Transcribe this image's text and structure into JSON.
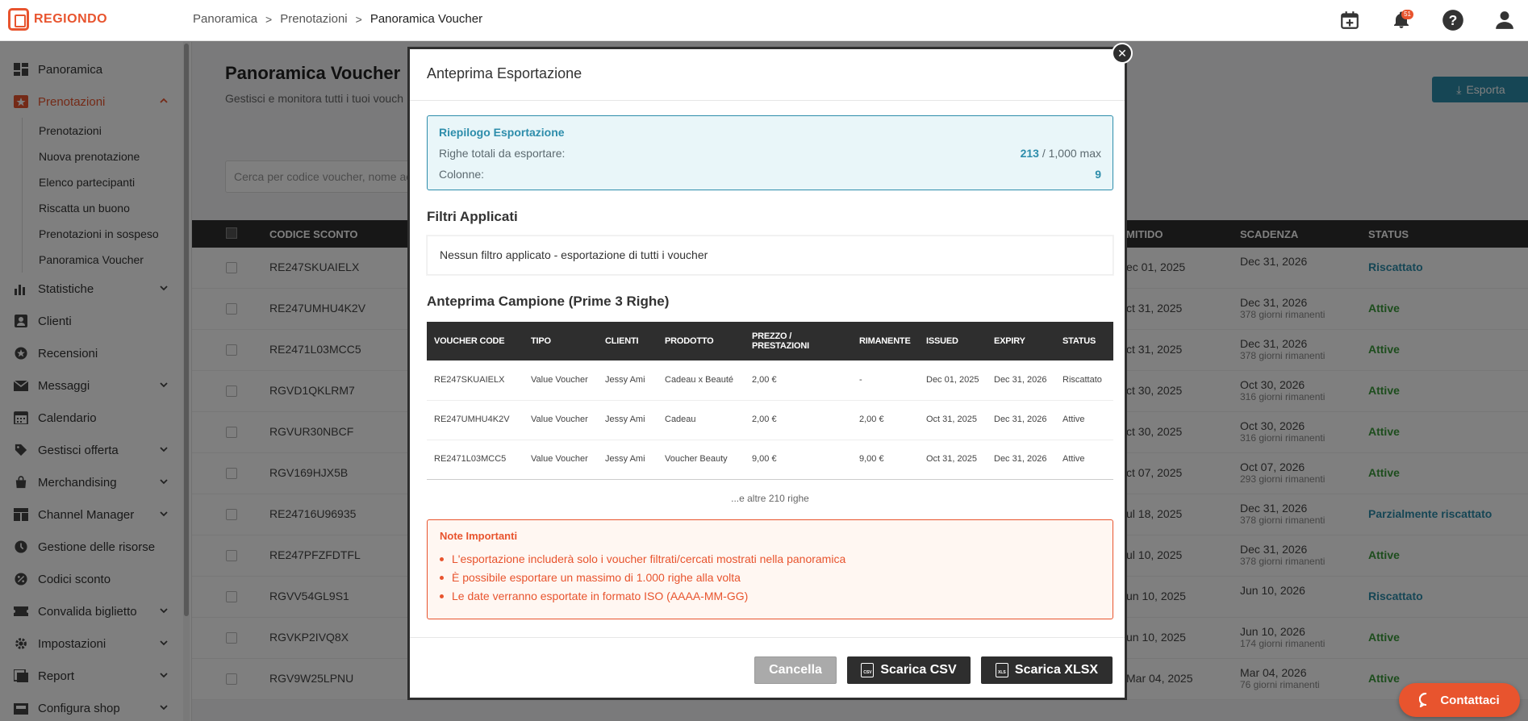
{
  "app": {
    "logo_text": "REGIONDO",
    "brand_color": "#e8542e",
    "accent_color": "#2d8dab"
  },
  "breadcrumb": [
    "Panoramica",
    "Prenotazioni",
    "Panoramica Voucher"
  ],
  "header": {
    "notif_count": "51"
  },
  "sidebar": {
    "items": [
      {
        "label": "Panoramica",
        "icon": "dashboard-icon"
      },
      {
        "label": "Prenotazioni",
        "icon": "star-ticket-icon",
        "active": true
      },
      {
        "label": "Statistiche",
        "icon": "bar-chart-icon"
      },
      {
        "label": "Clienti",
        "icon": "person-icon"
      },
      {
        "label": "Recensioni",
        "icon": "star-icon"
      },
      {
        "label": "Messaggi",
        "icon": "mail-icon"
      },
      {
        "label": "Calendario",
        "icon": "calendar-icon"
      },
      {
        "label": "Gestisci offerta",
        "icon": "tag-icon"
      },
      {
        "label": "Merchandising",
        "icon": "bag-icon"
      },
      {
        "label": "Channel Manager",
        "icon": "channel-icon"
      },
      {
        "label": "Gestione delle risorse",
        "icon": "resource-icon"
      },
      {
        "label": "Codici sconto",
        "icon": "discount-icon"
      },
      {
        "label": "Convalida biglietto",
        "icon": "ticket-icon"
      },
      {
        "label": "Impostazioni",
        "icon": "gear-icon"
      },
      {
        "label": "Report",
        "icon": "report-icon"
      },
      {
        "label": "Configura shop",
        "icon": "shop-icon"
      }
    ],
    "sub_items": [
      "Prenotazioni",
      "Nuova prenotazione",
      "Elenco partecipanti",
      "Riscatta un buono",
      "Prenotazioni in sospeso",
      "Panoramica Voucher"
    ]
  },
  "page": {
    "title": "Panoramica Voucher",
    "subtitle": "Gestisci e monitora tutti i tuoi vouch",
    "export_label": "Esporta",
    "search_placeholder": "Cerca per codice voucher, nome ac"
  },
  "table": {
    "headers": {
      "code": "CODICE SCONTO",
      "emitted": "MITIDO",
      "expiry": "SCADENZA",
      "status": "STATUS"
    },
    "rows": [
      {
        "code": "RE247SKUAIELX",
        "emitted": "ec 01, 2025",
        "expiry": "Dec 31, 2026",
        "remaining": "",
        "status": "Riscattato",
        "status_color": "blue"
      },
      {
        "code": "RE247UMHU4K2V",
        "emitted": "ct 31, 2025",
        "expiry": "Dec 31, 2026",
        "remaining": "378 giorni rimanenti",
        "status": "Attive",
        "status_color": "green"
      },
      {
        "code": "RE2471L03MCC5",
        "emitted": "ct 31, 2025",
        "expiry": "Dec 31, 2026",
        "remaining": "378 giorni rimanenti",
        "status": "Attive",
        "status_color": "green"
      },
      {
        "code": "RGVD1QKLRM7",
        "emitted": "ct 30, 2025",
        "expiry": "Oct 30, 2026",
        "remaining": "316 giorni rimanenti",
        "status": "Attive",
        "status_color": "green"
      },
      {
        "code": "RGVUR30NBCF",
        "emitted": "ct 30, 2025",
        "expiry": "Oct 30, 2026",
        "remaining": "316 giorni rimanenti",
        "status": "Attive",
        "status_color": "green"
      },
      {
        "code": "RGV169HJX5B",
        "emitted": "ct 07, 2025",
        "expiry": "Oct 07, 2026",
        "remaining": "293 giorni rimanenti",
        "status": "Attive",
        "status_color": "green"
      },
      {
        "code": "RE24716U96935",
        "emitted": "ul 18, 2025",
        "expiry": "Dec 31, 2026",
        "remaining": "378 giorni rimanenti",
        "status": "Parzialmente riscattato",
        "status_color": "blue"
      },
      {
        "code": "RE247PFZFDTFL",
        "emitted": "ul 10, 2025",
        "expiry": "Dec 31, 2026",
        "remaining": "378 giorni rimanenti",
        "status": "Attive",
        "status_color": "green"
      },
      {
        "code": "RGVV54GL9S1",
        "emitted": "un 10, 2025",
        "expiry": "Jun 10, 2026",
        "remaining": "",
        "status": "Riscattato",
        "status_color": "blue"
      },
      {
        "code": "RGVKP2IVQ8X",
        "emitted": "un 10, 2025",
        "expiry": "Jun 10, 2026",
        "remaining": "174 giorni rimanenti",
        "status": "Attive",
        "status_color": "green"
      },
      {
        "code": "RGV9W25LPNU",
        "emitted": "Mar 04, 2025",
        "expiry": "Mar 04, 2026",
        "remaining": "76 giorni rimanenti",
        "status": "Attive",
        "status_color": "green"
      }
    ]
  },
  "modal": {
    "title": "Anteprima Esportazione",
    "summary": {
      "title": "Riepilogo Esportazione",
      "rows_label": "Righe totali da esportare:",
      "rows_value": "213",
      "rows_max": " / 1,000 max",
      "cols_label": "Colonne:",
      "cols_value": "9"
    },
    "filters_title": "Filtri Applicati",
    "filters_text": "Nessun filtro applicato - esportazione di tutti i voucher",
    "sample_title": "Anteprima Campione (Prime 3 Righe)",
    "sample_headers": [
      "VOUCHER CODE",
      "TIPO",
      "CLIENTI",
      "PRODOTTO",
      "PREZZO / PRESTAZIONI",
      "RIMANENTE",
      "ISSUED",
      "EXPIRY",
      "STATUS"
    ],
    "sample_rows": [
      [
        "RE247SKUAIELX",
        "Value Voucher",
        "Jessy Ami",
        "Cadeau x Beauté",
        "2,00 €",
        "-",
        "Dec 01, 2025",
        "Dec 31, 2026",
        "Riscattato"
      ],
      [
        "RE247UMHU4K2V",
        "Value Voucher",
        "Jessy Ami",
        "Cadeau",
        "2,00 €",
        "2,00 €",
        "Oct 31, 2025",
        "Dec 31, 2026",
        "Attive"
      ],
      [
        "RE2471L03MCC5",
        "Value Voucher",
        "Jessy Ami",
        "Voucher Beauty",
        "9,00 €",
        "9,00 €",
        "Oct 31, 2025",
        "Dec 31, 2026",
        "Attive"
      ]
    ],
    "more_rows": "...e altre 210 righe",
    "notes_title": "Note Importanti",
    "notes": [
      "L'esportazione includerà solo i voucher filtrati/cercati mostrati nella panoramica",
      "È possibile esportare un massimo di 1.000 righe alla volta",
      "Le date verranno esportate in formato ISO (AAAA-MM-GG)"
    ],
    "cancel_label": "Cancella",
    "csv_label": "Scarica CSV",
    "xlsx_label": "Scarica XLSX",
    "csv_icon_text": "CSV",
    "xlsx_icon_text": "XLS"
  },
  "contact_label": "Contattaci"
}
